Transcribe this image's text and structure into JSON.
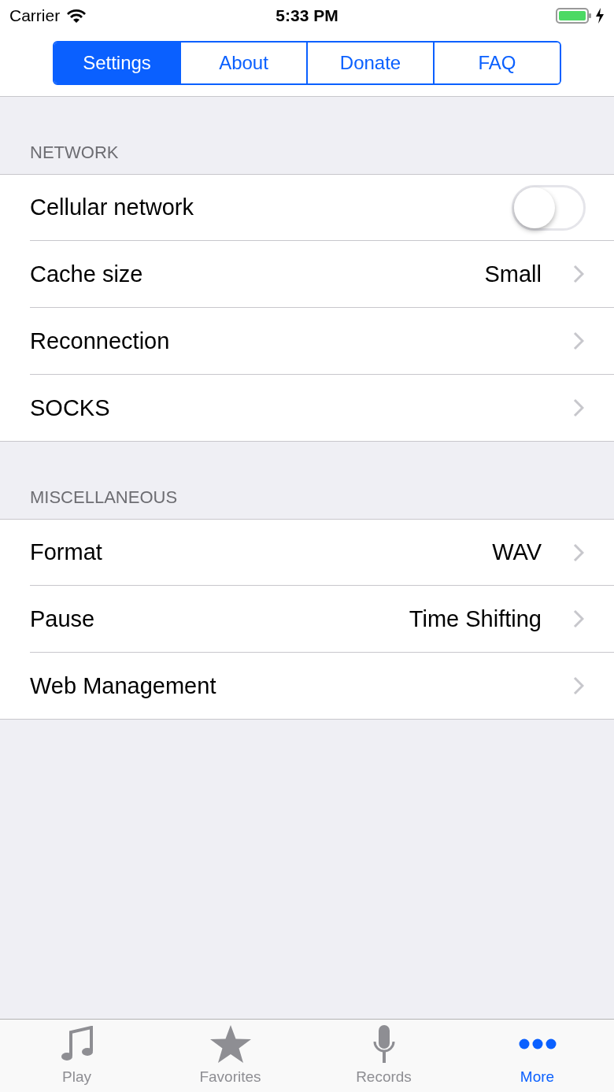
{
  "status_bar": {
    "carrier": "Carrier",
    "time": "5:33 PM",
    "charging": true
  },
  "segments": [
    {
      "label": "Settings",
      "selected": true
    },
    {
      "label": "About",
      "selected": false
    },
    {
      "label": "Donate",
      "selected": false
    },
    {
      "label": "FAQ",
      "selected": false
    }
  ],
  "sections": [
    {
      "header": "NETWORK",
      "rows": [
        {
          "kind": "toggle",
          "label": "Cellular network",
          "on": false
        },
        {
          "kind": "disclosure",
          "label": "Cache size",
          "value": "Small"
        },
        {
          "kind": "disclosure",
          "label": "Reconnection"
        },
        {
          "kind": "disclosure",
          "label": "SOCKS"
        }
      ]
    },
    {
      "header": "MISCELLANEOUS",
      "rows": [
        {
          "kind": "disclosure",
          "label": "Format",
          "value": "WAV"
        },
        {
          "kind": "disclosure",
          "label": "Pause",
          "value": "Time Shifting"
        },
        {
          "kind": "disclosure",
          "label": "Web Management"
        }
      ]
    }
  ],
  "tab_bar": [
    {
      "label": "Play",
      "selected": false
    },
    {
      "label": "Favorites",
      "selected": false
    },
    {
      "label": "Records",
      "selected": false
    },
    {
      "label": "More",
      "selected": true
    }
  ]
}
